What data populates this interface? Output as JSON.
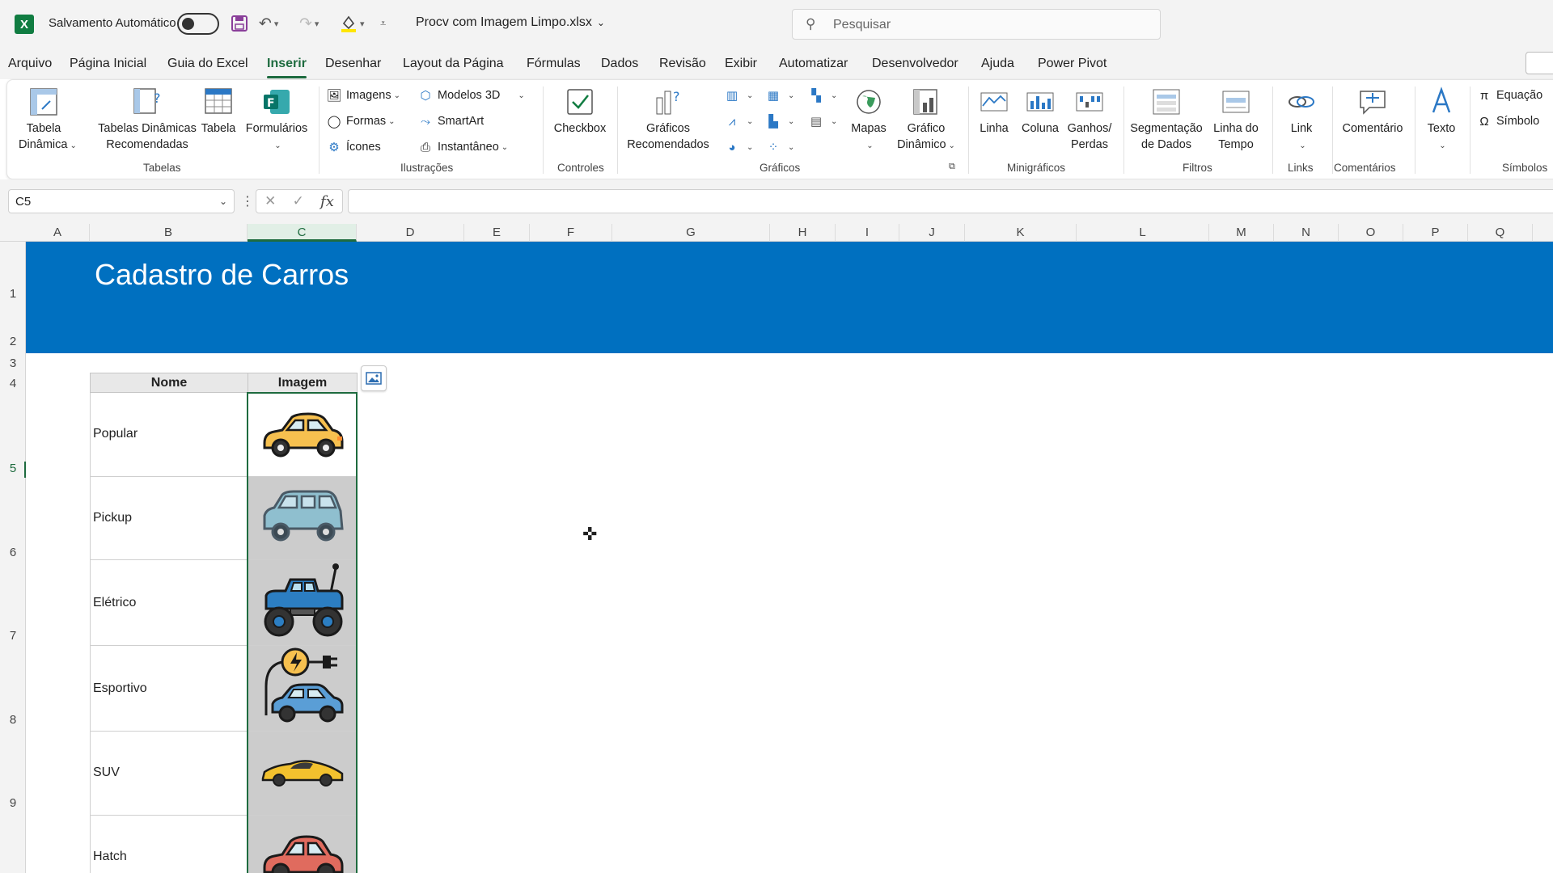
{
  "titlebar": {
    "app_logo": "X",
    "autosave_label": "Salvamento Automático",
    "filename": "Procv com Imagem Limpo.xlsx",
    "search_placeholder": "Pesquisar"
  },
  "menu": {
    "tabs": [
      "Arquivo",
      "Página Inicial",
      "Guia do Excel",
      "Inserir",
      "Desenhar",
      "Layout da Página",
      "Fórmulas",
      "Dados",
      "Revisão",
      "Exibir",
      "Automatizar",
      "Desenvolvedor",
      "Ajuda",
      "Power Pivot"
    ],
    "active_tab": "Inserir"
  },
  "ribbon": {
    "tabelas": {
      "tabela_dinamica": "Tabela\nDinâmica",
      "tabelas_recomendadas": "Tabelas Dinâmicas\nRecomendadas",
      "tabela": "Tabela",
      "formularios": "Formulários",
      "group": "Tabelas"
    },
    "ilustracoes": {
      "imagens": "Imagens",
      "formas": "Formas",
      "icones": "Ícones",
      "modelos3d": "Modelos 3D",
      "smartart": "SmartArt",
      "instantaneo": "Instantâneo",
      "group": "Ilustrações"
    },
    "controles": {
      "checkbox": "Checkbox",
      "group": "Controles"
    },
    "graficos": {
      "recomendados": "Gráficos\nRecomendados",
      "mapas": "Mapas",
      "dinamico": "Gráfico\nDinâmico",
      "group": "Gráficos"
    },
    "minigraficos": {
      "linha": "Linha",
      "coluna": "Coluna",
      "ganhos": "Ganhos/\nPerdas",
      "group": "Minigráficos"
    },
    "filtros": {
      "segmentacao": "Segmentação\nde Dados",
      "linha_tempo": "Linha do\nTempo",
      "group": "Filtros"
    },
    "links": {
      "link": "Link",
      "group": "Links"
    },
    "comentarios": {
      "comentario": "Comentário",
      "group": "Comentários"
    },
    "texto": {
      "texto": "Texto"
    },
    "simbolos": {
      "equacao": "Equação",
      "simbolo": "Símbolo",
      "group": "Símbolos"
    }
  },
  "formula_bar": {
    "name_box": "C5",
    "formula": ""
  },
  "columns": [
    "A",
    "B",
    "C",
    "D",
    "E",
    "F",
    "G",
    "H",
    "I",
    "J",
    "K",
    "L",
    "M",
    "N",
    "O",
    "P",
    "Q"
  ],
  "selected_column": "C",
  "rows": [
    "1",
    "2",
    "3",
    "4",
    "5",
    "6",
    "7",
    "8",
    "9"
  ],
  "selected_row": "5",
  "sheet": {
    "banner_title": "Cadastro de Carros",
    "banner_color": "#0070c0",
    "table": {
      "headers": [
        "Nome",
        "Imagem"
      ],
      "rows": [
        {
          "nome": "Popular",
          "icon": "yellow-sedan-car-icon"
        },
        {
          "nome": "Pickup",
          "icon": "light-blue-hatchback-car-icon"
        },
        {
          "nome": "Elétrico",
          "icon": "blue-monster-truck-icon"
        },
        {
          "nome": "Esportivo",
          "icon": "electric-charging-car-icon"
        },
        {
          "nome": "SUV",
          "icon": "yellow-sports-car-icon"
        },
        {
          "nome": "Hatch",
          "icon": "red-compact-car-icon"
        }
      ]
    }
  },
  "colors": {
    "excel_green": "#1e6b3f",
    "accent": "#107c41"
  }
}
